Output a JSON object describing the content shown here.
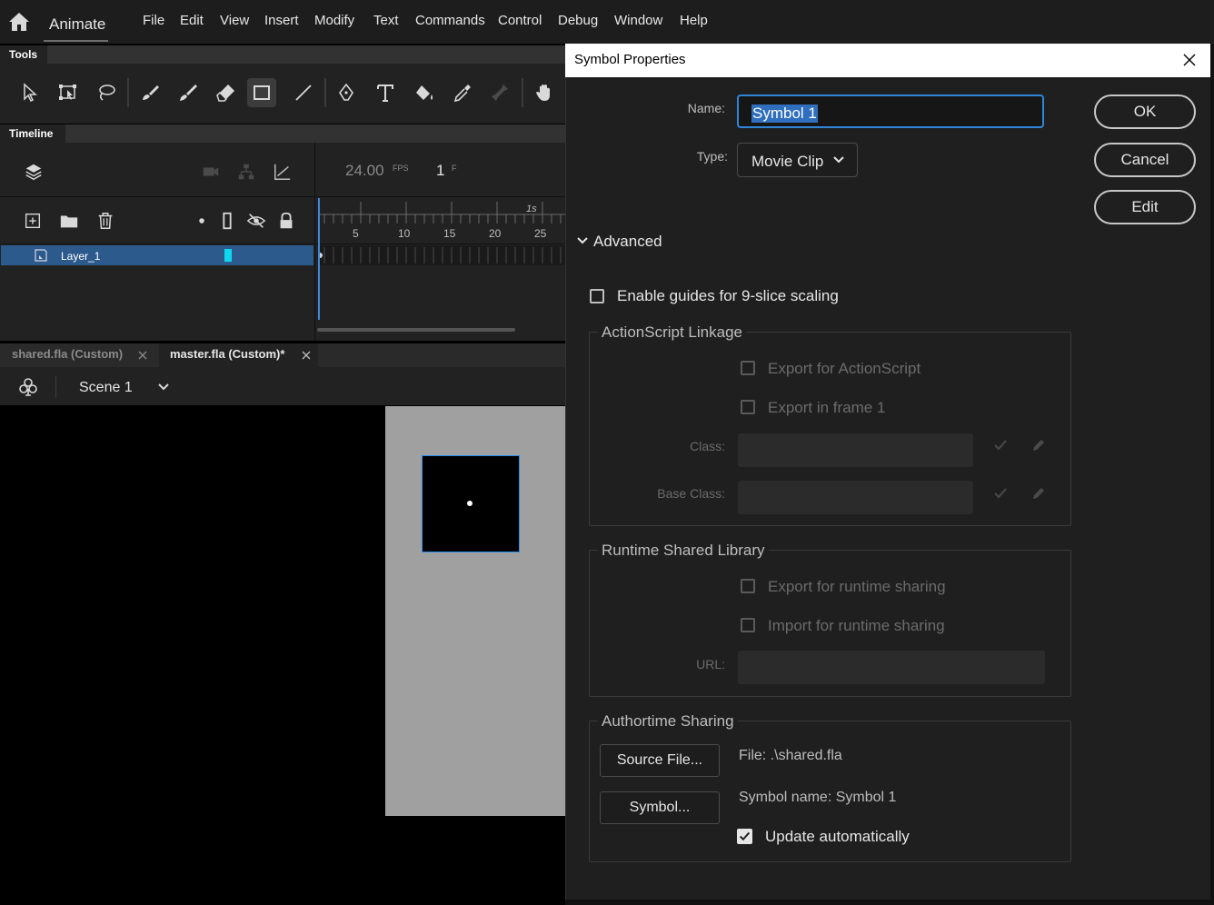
{
  "app": {
    "name": "Animate",
    "menu": [
      "File",
      "Edit",
      "View",
      "Insert",
      "Modify",
      "Text",
      "Commands",
      "Control",
      "Debug",
      "Window",
      "Help"
    ]
  },
  "tools_panel": {
    "tab_label": "Tools",
    "tools": [
      "selection-tool-icon",
      "free-transform-tool-icon",
      "lasso-tool-icon",
      "paint-brush-tool-icon",
      "brush-tool-icon",
      "eraser-tool-icon",
      "rectangle-tool-icon",
      "line-tool-icon",
      "pen-tool-icon",
      "text-tool-icon",
      "paint-bucket-tool-icon",
      "eyedropper-tool-icon",
      "bone-tool-icon",
      "hand-tool-icon"
    ],
    "selected_tool": "rectangle-tool-icon"
  },
  "timeline": {
    "tab_label": "Timeline",
    "fps_value": "24.00",
    "fps_unit": "FPS",
    "frame_value": "1",
    "frame_unit": "F",
    "ruler_labels": [
      "5",
      "10",
      "15",
      "20",
      "25"
    ],
    "ruler_second_label": "1s",
    "layer": {
      "name": "Layer_1",
      "color": "#10d7f0"
    }
  },
  "documents": {
    "tabs": [
      {
        "label": "shared.fla (Custom)",
        "active": false
      },
      {
        "label": "master.fla (Custom)*",
        "active": true
      }
    ],
    "scene": "Scene 1"
  },
  "dialog": {
    "title": "Symbol Properties",
    "name_label": "Name:",
    "name_value": "Symbol 1",
    "type_label": "Type:",
    "type_value": "Movie Clip",
    "buttons": {
      "ok": "OK",
      "cancel": "Cancel",
      "edit": "Edit"
    },
    "advanced_label": "Advanced",
    "nine_slice_label": "Enable guides for 9-slice scaling",
    "actionscript": {
      "title": "ActionScript Linkage",
      "export_as": "Export for ActionScript",
      "export_frame1": "Export in frame 1",
      "class_label": "Class:",
      "base_class_label": "Base Class:"
    },
    "runtime": {
      "title": "Runtime Shared Library",
      "export_label": "Export for runtime sharing",
      "import_label": "Import for runtime sharing",
      "url_label": "URL:"
    },
    "authortime": {
      "title": "Authortime Sharing",
      "source_button": "Source File...",
      "symbol_button": "Symbol...",
      "file_text": "File: .\\shared.fla",
      "symbol_name_text": "Symbol name: Symbol 1",
      "update_label": "Update automatically",
      "update_checked": true
    }
  }
}
